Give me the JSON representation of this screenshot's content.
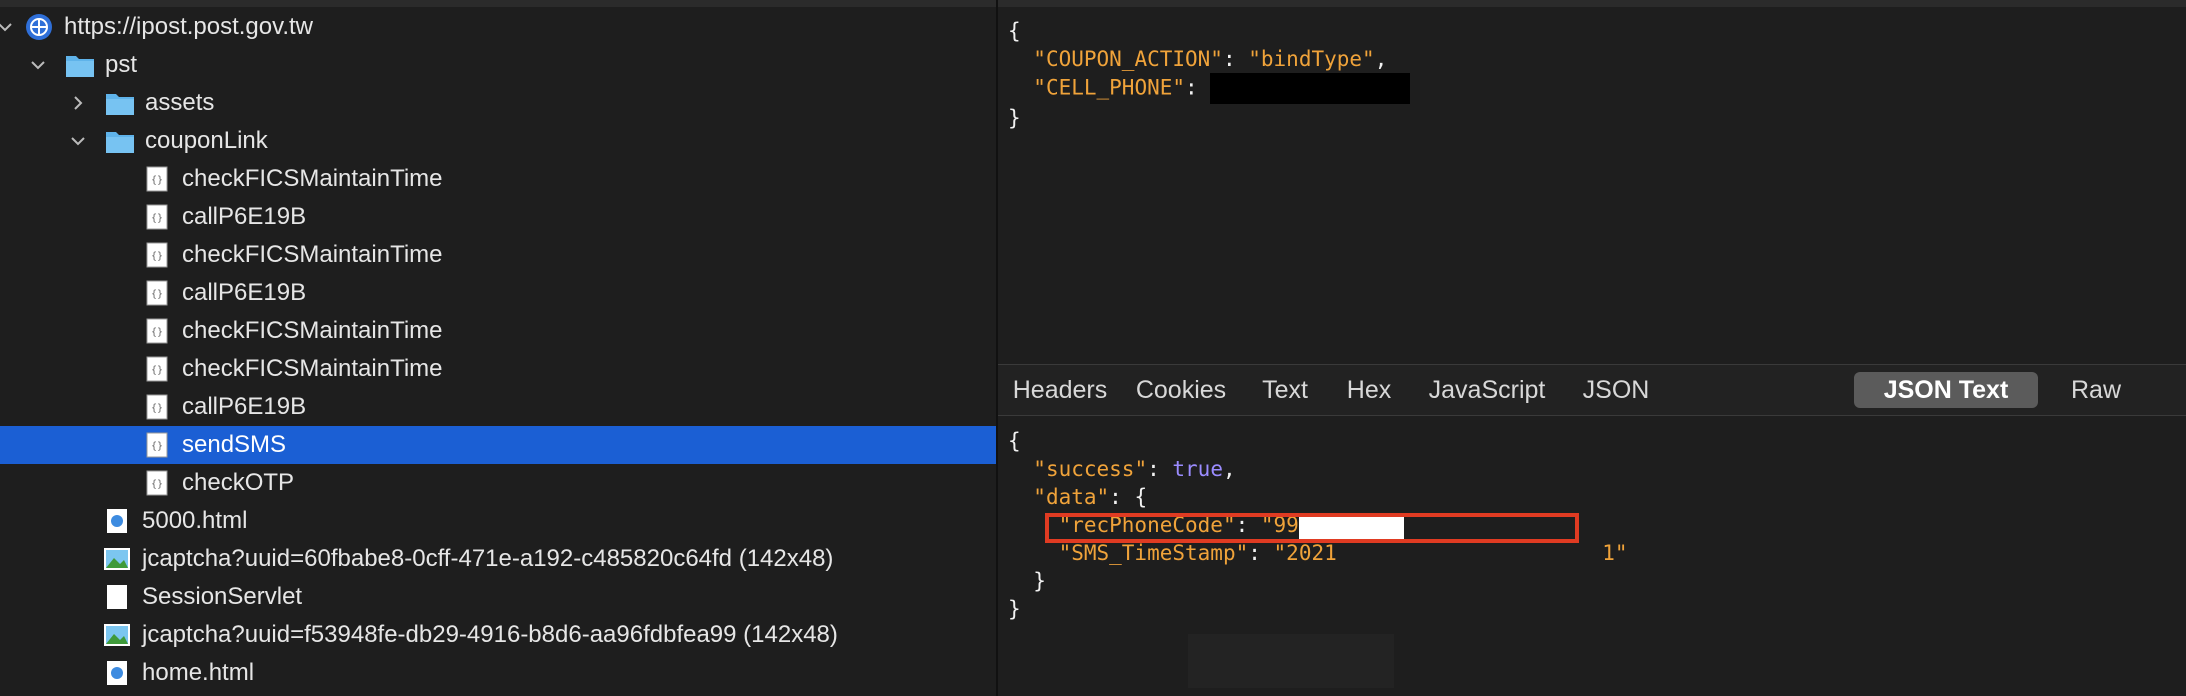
{
  "tree": {
    "host": "https://ipost.post.gov.tw",
    "folder_pst": "pst",
    "folder_assets": "assets",
    "folder_couponLink": "couponLink",
    "items": [
      "checkFICSMaintainTime",
      "callP6E19B",
      "checkFICSMaintainTime",
      "callP6E19B",
      "checkFICSMaintainTime",
      "checkFICSMaintainTime",
      "callP6E19B",
      "sendSMS",
      "checkOTP"
    ],
    "selected": "sendSMS",
    "files": [
      "5000.html",
      "jcaptcha?uuid=60fbabe8-0cff-471e-a192-c485820c64fd (142x48)",
      "SessionServlet",
      "jcaptcha?uuid=f53948fe-db29-4916-b8d6-aa96fdbfea99 (142x48)",
      "home.html"
    ]
  },
  "request": {
    "open": "{",
    "k1": "\"COUPON_ACTION\"",
    "v1": "\"bindType\"",
    "k2": "\"CELL_PHONE\"",
    "close": "}"
  },
  "tabs": [
    "Headers",
    "Cookies",
    "Text",
    "Hex",
    "JavaScript",
    "JSON",
    "JSON Text",
    "Raw"
  ],
  "active_tab": "JSON Text",
  "response": {
    "open": "{",
    "k_success": "\"success\"",
    "v_success": "true",
    "k_data": "\"data\"",
    "k_rec": "\"recPhoneCode\"",
    "v_rec_prefix": "\"99",
    "k_sms": "\"SMS_TimeStamp\"",
    "v_sms_prefix": "\"2021",
    "v_sms_suffix": "1\"",
    "inner_close": "}",
    "close": "}"
  },
  "colors": {
    "selection": "#1b5fd4",
    "highlight_box": "#e03b22",
    "json_key": "#f0a33a",
    "json_bool": "#9b8cff"
  }
}
